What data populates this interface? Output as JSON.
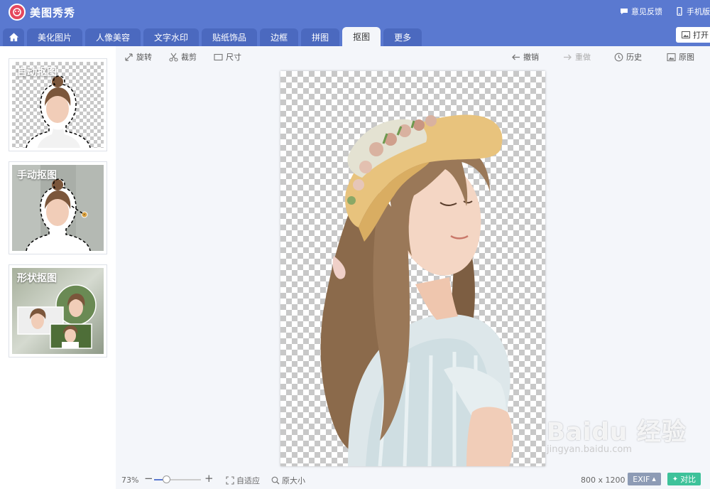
{
  "app": {
    "title": "美图秀秀"
  },
  "header_right": {
    "feedback": "意见反馈",
    "mobile": "手机版"
  },
  "tabs": [
    {
      "label": "美化图片"
    },
    {
      "label": "人像美容"
    },
    {
      "label": "文字水印"
    },
    {
      "label": "贴纸饰品"
    },
    {
      "label": "边框"
    },
    {
      "label": "拼图"
    },
    {
      "label": "抠图",
      "active": true
    },
    {
      "label": "更多"
    }
  ],
  "open_button": {
    "label": "打开"
  },
  "cutout_modes": [
    {
      "label": "自动抠图"
    },
    {
      "label": "手动抠图"
    },
    {
      "label": "形状抠图"
    }
  ],
  "toolbar": {
    "rotate": "旋转",
    "crop": "裁剪",
    "size": "尺寸",
    "undo": "撤销",
    "redo": "重做",
    "history": "历史",
    "original": "原图"
  },
  "bottom": {
    "zoom": "73%",
    "zoom_fraction": 0.26,
    "fit": "自适应",
    "actual_size": "原大小",
    "dimensions": "800 x 1200",
    "exif": "EXIF",
    "compare": "对比"
  },
  "watermark": {
    "main": "Baidu 经验",
    "sub": "jingyan.baidu.com"
  },
  "colors": {
    "header": "#5a79d0",
    "tab": "#4b69bf",
    "compare": "#3ec29a",
    "exif": "#8d9bb5",
    "logo": "#e5475d"
  }
}
